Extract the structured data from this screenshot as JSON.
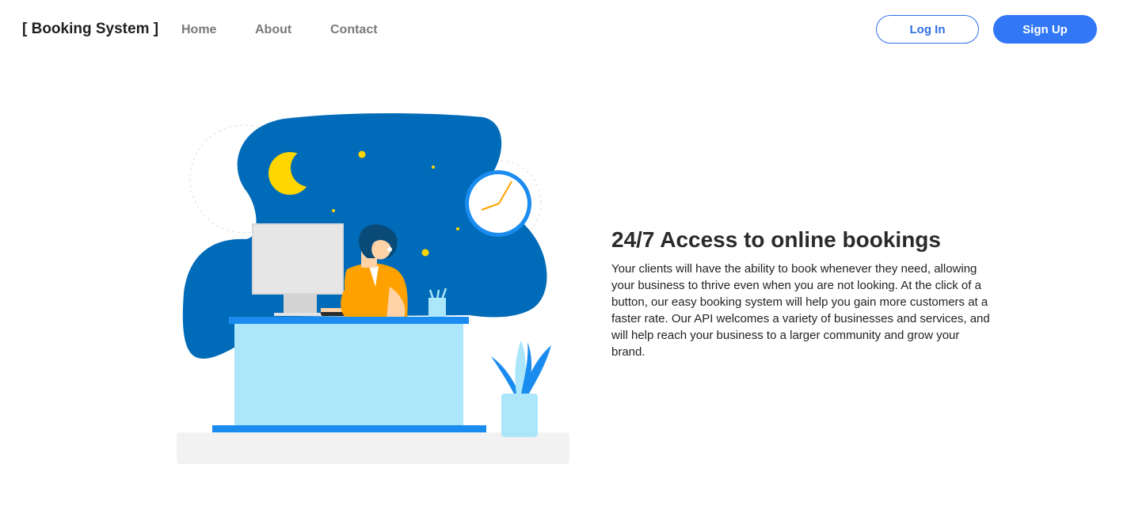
{
  "header": {
    "brand": "[ Booking System ]",
    "nav": {
      "home": "Home",
      "about": "About",
      "contact": "Contact"
    },
    "login_label": "Log In",
    "signup_label": "Sign Up"
  },
  "hero": {
    "title": "24/7 Access to online bookings",
    "body": "Your clients will have the ability to book whenever they need, allowing your business to thrive even when you are not looking. At the click of a button, our easy booking system will help you gain more customers at a faster rate. Our API welcomes a variety of businesses and services, and will help reach your business to a larger community and grow your brand.",
    "illustration_icon": "receptionist-night-illustration"
  },
  "colors": {
    "accent": "#3277f6",
    "night_blob": "#006bb8",
    "desk": "#abe6fb",
    "desk_edge": "#1a8cf0",
    "moon": "#ffd600",
    "shirt": "#ffa200"
  }
}
